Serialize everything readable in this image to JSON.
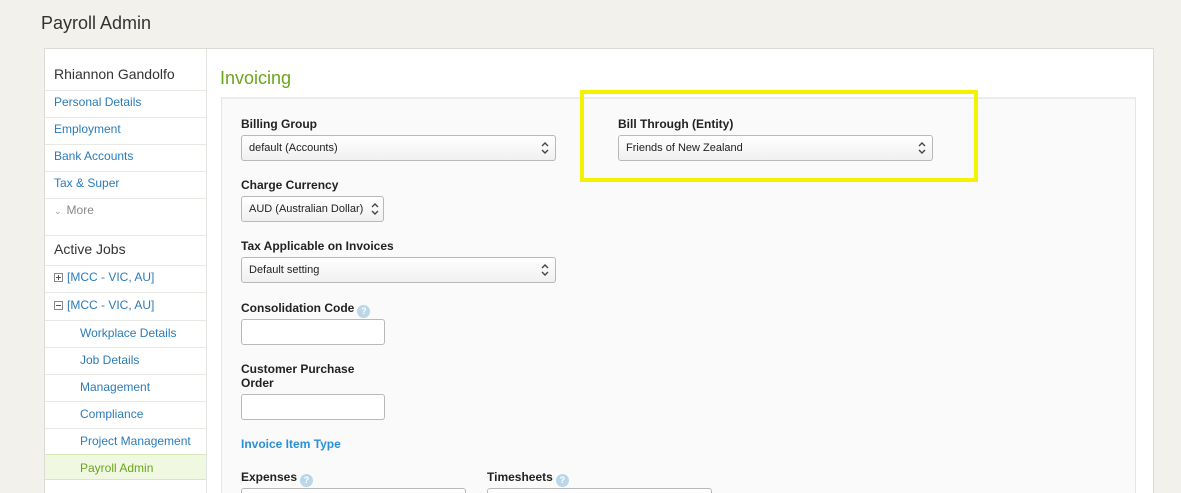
{
  "app": {
    "title": "Payroll Admin"
  },
  "sidebar": {
    "person_name": "Rhiannon Gandolfo",
    "links": [
      {
        "label": "Personal Details"
      },
      {
        "label": "Employment"
      },
      {
        "label": "Bank Accounts"
      },
      {
        "label": "Tax & Super"
      }
    ],
    "more_label": "More",
    "active_jobs_heading": "Active Jobs",
    "jobs": [
      {
        "label": "[MCC - VIC, AU]",
        "expanded": false
      },
      {
        "label": "[MCC - VIC, AU]",
        "expanded": true
      }
    ],
    "job_items": [
      {
        "label": "Workplace Details"
      },
      {
        "label": "Job Details"
      },
      {
        "label": "Management"
      },
      {
        "label": "Compliance"
      },
      {
        "label": "Project Management"
      },
      {
        "label": "Payroll Admin",
        "active": true
      }
    ]
  },
  "main": {
    "section_title": "Invoicing",
    "billing_group": {
      "label": "Billing Group",
      "value": "default (Accounts)"
    },
    "bill_through": {
      "label": "Bill Through (Entity)",
      "value": "Friends of New Zealand"
    },
    "charge_currency": {
      "label": "Charge Currency",
      "value": "AUD (Australian Dollar)"
    },
    "tax_applicable": {
      "label": "Tax Applicable on Invoices",
      "value": "Default setting"
    },
    "consolidation_code": {
      "label": "Consolidation Code",
      "value": ""
    },
    "customer_po": {
      "label_line1": "Customer Purchase",
      "label_line2": "Order",
      "value": ""
    },
    "invoice_item_type": {
      "label": "Invoice Item Type"
    },
    "expenses": {
      "label": "Expenses"
    },
    "timesheets": {
      "label": "Timesheets"
    },
    "help_glyph": "?"
  },
  "colors": {
    "accent_green": "#6aa61d",
    "link_blue": "#2b7bb9",
    "highlight_yellow": "#f3f200"
  }
}
